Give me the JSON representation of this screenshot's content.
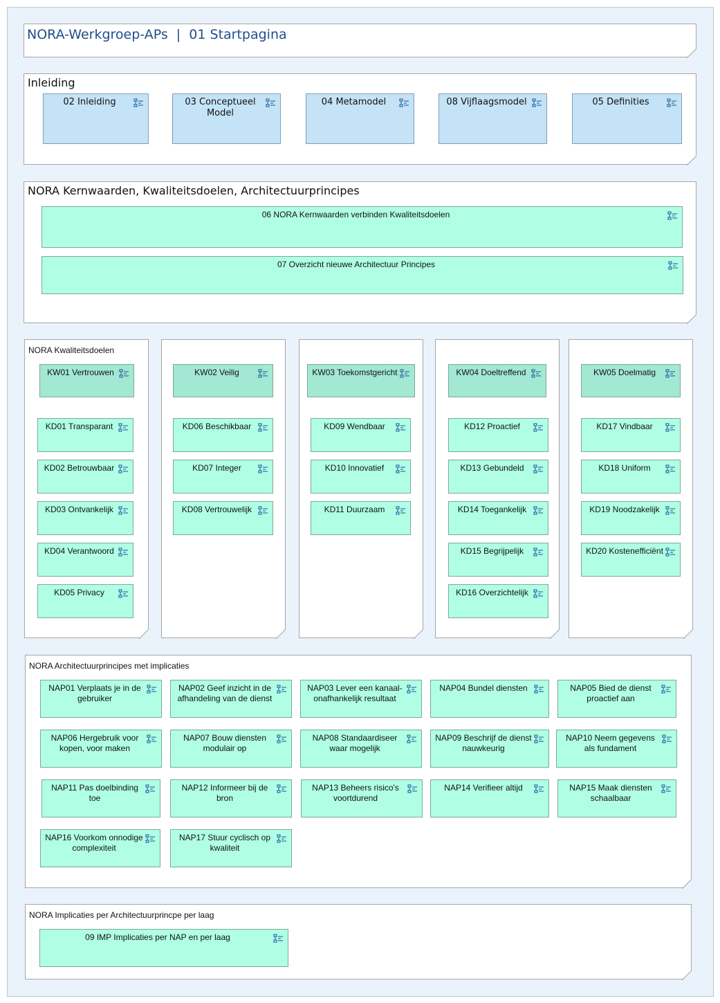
{
  "header": {
    "title": "NORA-Werkgroep-APs  |  01 Startpagina"
  },
  "inleiding": {
    "title": "Inleiding",
    "items": [
      {
        "label": "02 Inleiding"
      },
      {
        "label": "03 Conceptueel Model"
      },
      {
        "label": "04 Metamodel"
      },
      {
        "label": "08 Vijflaagsmodel"
      },
      {
        "label": "05 Definities"
      }
    ]
  },
  "kernwaarden": {
    "title": "NORA Kernwaarden, Kwaliteitsdoelen, Architectuurprincipes",
    "items": [
      {
        "label": "06 NORA Kernwaarden verbinden Kwaliteitsdoelen"
      },
      {
        "label": "07 Overzicht nieuwe Architectuur Principes"
      }
    ]
  },
  "kwaliteitsdoelen": {
    "title": "NORA Kwaliteitsdoelen",
    "columns": [
      {
        "kw": "KW01 Vertrouwen",
        "kd": [
          "KD01 Transparant",
          "KD02 Betrouwbaar",
          "KD03 Ontvankelijk",
          "KD04 Verantwoord",
          "KD05 Privacy"
        ]
      },
      {
        "kw": "KW02 Veilig",
        "kd": [
          "KD06 Beschikbaar",
          "KD07 Integer",
          "KD08 Vertrouwelijk"
        ]
      },
      {
        "kw": "KW03 Toekomstgericht",
        "kd": [
          "KD09 Wendbaar",
          "KD10 Innovatief",
          "KD11 Duurzaam"
        ]
      },
      {
        "kw": "KW04 Doeltreffend",
        "kd": [
          "KD12 Proactief",
          "KD13 Gebundeld",
          "KD14 Toegankelijk",
          "KD15 Begrijpelijk",
          "KD16 Overzichtelijk"
        ]
      },
      {
        "kw": "KW05 Doelmatig",
        "kd": [
          "KD17 Vindbaar",
          "KD18 Uniform",
          "KD19 Noodzakelijk",
          "KD20 Kostenefficiënt"
        ]
      }
    ]
  },
  "principes": {
    "title": "NORA Architectuurprincipes met implicaties",
    "items": [
      {
        "label": "NAP01 Verplaats je in de gebruiker"
      },
      {
        "label": "NAP02 Geef inzicht in de afhandeling van de dienst"
      },
      {
        "label": "NAP03 Lever een kanaal-onafhankelijk resultaat"
      },
      {
        "label": "NAP04 Bundel diensten"
      },
      {
        "label": "NAP05 Bied de dienst proactief aan"
      },
      {
        "label": "NAP06 Hergebruik voor kopen, voor maken"
      },
      {
        "label": "NAP07 Bouw diensten modulair op"
      },
      {
        "label": "NAP08 Standaardiseer waar mogelijk"
      },
      {
        "label": "NAP09 Beschrijf de dienst nauwkeurig"
      },
      {
        "label": "NAP10 Neem gegevens als fundament"
      },
      {
        "label": "NAP11 Pas doelbinding toe"
      },
      {
        "label": "NAP12 Informeer bij de bron"
      },
      {
        "label": "NAP13 Beheers risico's voortdurend"
      },
      {
        "label": "NAP14 Verifieer altijd"
      },
      {
        "label": "NAP15 Maak diensten schaalbaar"
      },
      {
        "label": "NAP16 Voorkom onnodige complexiteit"
      },
      {
        "label": "NAP17 Stuur cyclisch op kwaliteit"
      }
    ]
  },
  "implicaties": {
    "title": "NORA Implicaties per Architectuurprincpe per laag",
    "items": [
      {
        "label": "09 IMP Implicaties per NAP en per laag"
      }
    ]
  },
  "colors": {
    "canvas": "#eaf3fb",
    "blue_box": "#c5e3f6",
    "mint_box": "#b0ffe4",
    "kw_box": "#a2e8d2",
    "title_blue": "#1f4e8c",
    "icon": "#2e6da4"
  },
  "icon_name": "view-reference-icon"
}
